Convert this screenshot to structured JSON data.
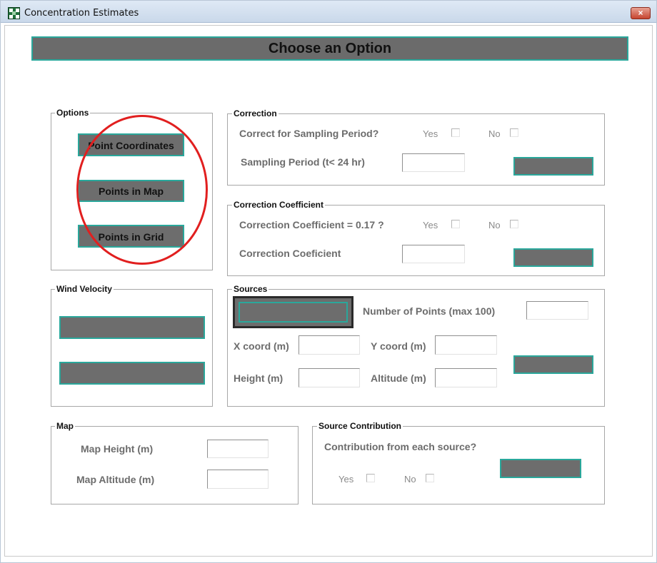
{
  "window": {
    "title": "Concentration Estimates",
    "close_glyph": "×"
  },
  "header": {
    "title": "Choose an Option"
  },
  "options": {
    "legend": "Options",
    "buttons": [
      "Point Coordinates",
      "Points in Map",
      "Points in Grid"
    ]
  },
  "correction": {
    "legend": "Correction",
    "question": "Correct for Sampling Period?",
    "yes": "Yes",
    "no": "No",
    "period_label": "Sampling Period  (t< 24 hr)",
    "period_value": ""
  },
  "coefficient": {
    "legend": "Correction Coefficient",
    "question": "Correction Coefficient = 0.17 ?",
    "yes": "Yes",
    "no": "No",
    "value_label": "Correction Coeficient",
    "value": ""
  },
  "wind": {
    "legend": "Wind Velocity"
  },
  "sources": {
    "legend": "Sources",
    "num_points_label": "Number  of  Points  (max 100)",
    "x_label": "X coord (m)",
    "y_label": "Y coord (m)",
    "height_label": "Height (m)",
    "altitude_label": "Altitude (m)"
  },
  "map": {
    "legend": "Map",
    "height_label": "Map Height (m)",
    "altitude_label": "Map Altitude (m)"
  },
  "contribution": {
    "legend": "Source Contribution",
    "question": "Contribution from each source?",
    "yes": "Yes",
    "no": "No"
  },
  "colors": {
    "button_fill": "#6d6d6d",
    "button_border": "#2aa79b",
    "annotation": "#e11f1f"
  }
}
